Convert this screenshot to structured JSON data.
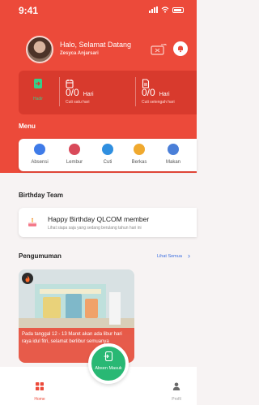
{
  "status_bar": {
    "time": "9:41"
  },
  "header": {
    "greeting": "Halo, Selamat Datang",
    "user_name": "Zesyca Anjarsari"
  },
  "summary": {
    "hadir_label": "Hadir",
    "stats": [
      {
        "value": "0/0",
        "unit": "Hari",
        "label": "Cuti satu hari"
      },
      {
        "value": "0/0",
        "unit": "Hari",
        "label": "Cuti setengah hari"
      }
    ]
  },
  "menu": {
    "title": "Menu",
    "items": [
      {
        "label": "Absensi",
        "icon": "absensi-icon",
        "color": "#3f7be8"
      },
      {
        "label": "Lembur",
        "icon": "lembur-icon",
        "color": "#d94a5a"
      },
      {
        "label": "Cuti",
        "icon": "cuti-icon",
        "color": "#2f8fe0"
      },
      {
        "label": "Berkas",
        "icon": "berkas-icon",
        "color": "#f0a92e"
      },
      {
        "label": "Makan",
        "icon": "makan-icon",
        "color": "#4a7fd8"
      }
    ]
  },
  "birthday": {
    "title": "Birthday Team",
    "heading": "Happy Birthday QLCOM member",
    "subtitle": "Lihat siapa saja yang sedang berulang tahun hari ini"
  },
  "announcements": {
    "title": "Pengumuman",
    "see_all": "Lihat Semua",
    "items": [
      {
        "text": "Pada tanggal 12 - 13 Maret akan ada libur hari raya idul fitri, selamat berlibur semuanya"
      }
    ]
  },
  "bottom_nav": {
    "home": "Home",
    "profile": "Profil",
    "absen": "Absen Masuk"
  },
  "colors": {
    "primary": "#ec4a3a",
    "card_dark": "#d83a2d",
    "green": "#29b874",
    "link": "#3a6de0"
  }
}
